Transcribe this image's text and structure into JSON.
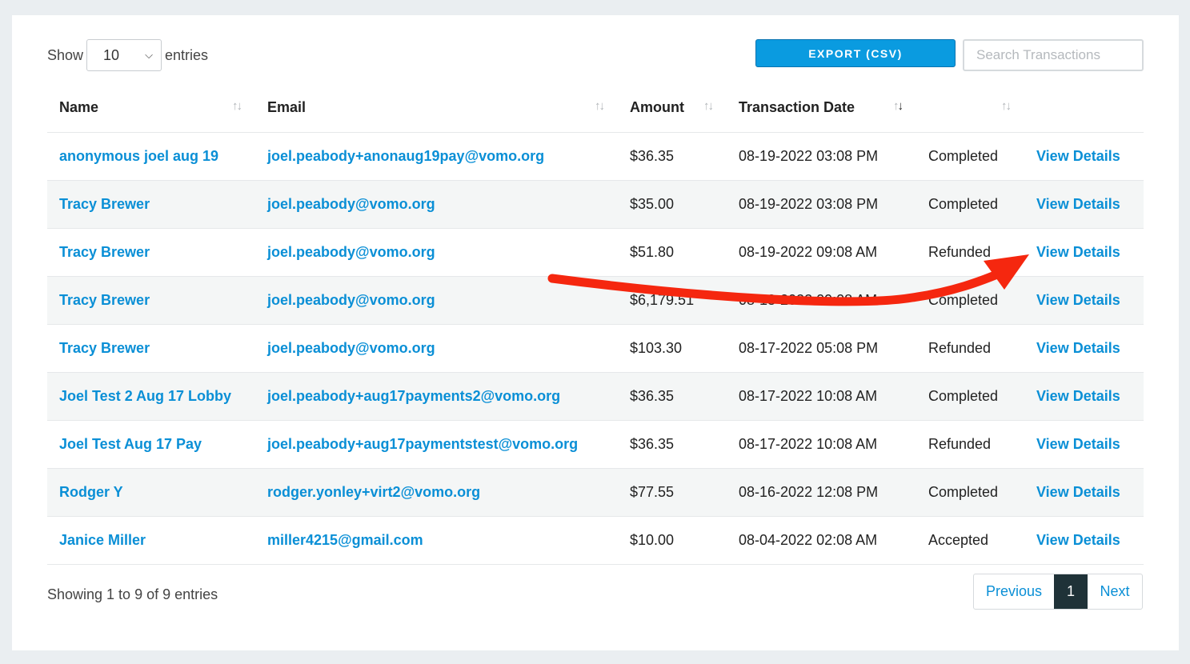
{
  "controls": {
    "show_label": "Show",
    "entries_value": "10",
    "entries_label": "entries",
    "export_label": "EXPORT (CSV)",
    "search_placeholder": "Search Transactions"
  },
  "table": {
    "columns": [
      "Name",
      "Email",
      "Amount",
      "Transaction Date",
      "",
      ""
    ],
    "rows": [
      {
        "name": "anonymous joel aug 19",
        "email": "joel.peabody+anonaug19pay@vomo.org",
        "amount": "$36.35",
        "date": "08-19-2022 03:08 PM",
        "status": "Completed",
        "action": "View Details"
      },
      {
        "name": "Tracy Brewer",
        "email": "joel.peabody@vomo.org",
        "amount": "$35.00",
        "date": "08-19-2022 03:08 PM",
        "status": "Completed",
        "action": "View Details"
      },
      {
        "name": "Tracy Brewer",
        "email": "joel.peabody@vomo.org",
        "amount": "$51.80",
        "date": "08-19-2022 09:08 AM",
        "status": "Refunded",
        "action": "View Details"
      },
      {
        "name": "Tracy Brewer",
        "email": "joel.peabody@vomo.org",
        "amount": "$6,179.51",
        "date": "08-18-2022 09:08 AM",
        "status": "Completed",
        "action": "View Details"
      },
      {
        "name": "Tracy Brewer",
        "email": "joel.peabody@vomo.org",
        "amount": "$103.30",
        "date": "08-17-2022 05:08 PM",
        "status": "Refunded",
        "action": "View Details"
      },
      {
        "name": "Joel Test 2 Aug 17 Lobby",
        "email": "joel.peabody+aug17payments2@vomo.org",
        "amount": "$36.35",
        "date": "08-17-2022 10:08 AM",
        "status": "Completed",
        "action": "View Details"
      },
      {
        "name": "Joel Test Aug 17 Pay",
        "email": "joel.peabody+aug17paymentstest@vomo.org",
        "amount": "$36.35",
        "date": "08-17-2022 10:08 AM",
        "status": "Refunded",
        "action": "View Details"
      },
      {
        "name": "Rodger Y",
        "email": "rodger.yonley+virt2@vomo.org",
        "amount": "$77.55",
        "date": "08-16-2022 12:08 PM",
        "status": "Completed",
        "action": "View Details"
      },
      {
        "name": "Janice Miller",
        "email": "miller4215@gmail.com",
        "amount": "$10.00",
        "date": "08-04-2022 02:08 AM",
        "status": "Accepted",
        "action": "View Details"
      }
    ]
  },
  "footer": {
    "info": "Showing 1 to 9 of 9 entries",
    "previous": "Previous",
    "current_page": "1",
    "next": "Next"
  },
  "colors": {
    "accent": "#0a9be0",
    "link": "#0a8fd6",
    "annotation_arrow": "#f5270f",
    "active_page": "#1f3238"
  },
  "annotation": {
    "icon": "red-arrow-icon"
  }
}
